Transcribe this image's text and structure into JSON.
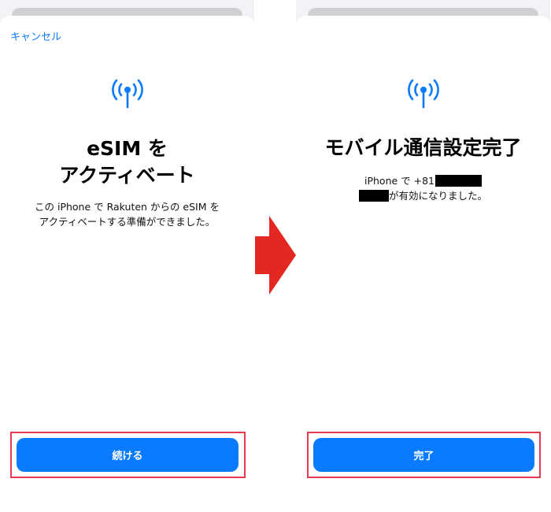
{
  "left_screen": {
    "cancel_label": "キャンセル",
    "title_line1": "eSIM を",
    "title_line2": "アクティベート",
    "description_line1": "この iPhone で Rakuten からの eSIM を",
    "description_line2": "アクティベートする準備ができました。",
    "continue_label": "続ける"
  },
  "right_screen": {
    "title": "モバイル通信設定完了",
    "description_prefix": "iPhone で +81",
    "description_suffix": "が有効になりました。",
    "done_label": "完了"
  },
  "icons": {
    "signal": "cellular-signal-icon",
    "arrow": "right-arrow-icon"
  },
  "colors": {
    "accent": "#0a7aff",
    "highlight_outline": "#e4394f",
    "arrow": "#e32822"
  }
}
